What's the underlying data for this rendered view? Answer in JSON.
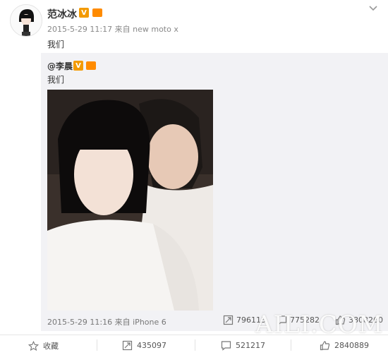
{
  "post": {
    "author": "范冰冰",
    "verified_badge": "V",
    "timestamp": "2015-5-29 11:17",
    "source_prefix": "来自",
    "source": "new moto x",
    "text": "我们"
  },
  "repost": {
    "author": "@李晨",
    "verified_badge": "V",
    "text": "我们",
    "timestamp": "2015-5-29 11:16",
    "source_prefix": "来自",
    "source": "iPhone 6",
    "reposts": "796113",
    "comments": "775282",
    "likes": "3808260"
  },
  "actions": {
    "favorite_label": "收藏",
    "repost_count": "435097",
    "comment_count": "521217",
    "like_count": "2840889"
  },
  "watermark": "AILI.COM",
  "colors": {
    "accent_badge": "#f39a00",
    "repost_bg": "#f2f2f5",
    "meta_text": "#888888"
  }
}
